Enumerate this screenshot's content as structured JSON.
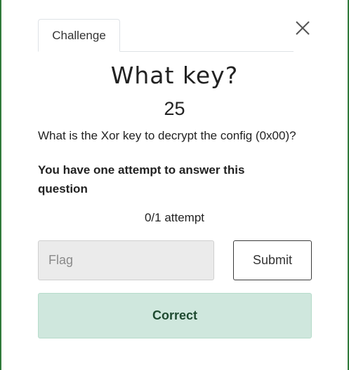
{
  "tabs": [
    {
      "label": "Challenge"
    }
  ],
  "challenge": {
    "name": "What key?",
    "points": "25",
    "description": "What is the Xor key to decrypt the config (0x00)?",
    "attempt_warning": "You have one attempt to answer this question",
    "attempts_text": "0/1 attempt"
  },
  "form": {
    "flag_placeholder": "Flag",
    "flag_value": "",
    "submit_label": "Submit"
  },
  "result": {
    "status": "Correct",
    "color": "#cfe7dd"
  },
  "icons": {
    "close": "close-icon"
  }
}
